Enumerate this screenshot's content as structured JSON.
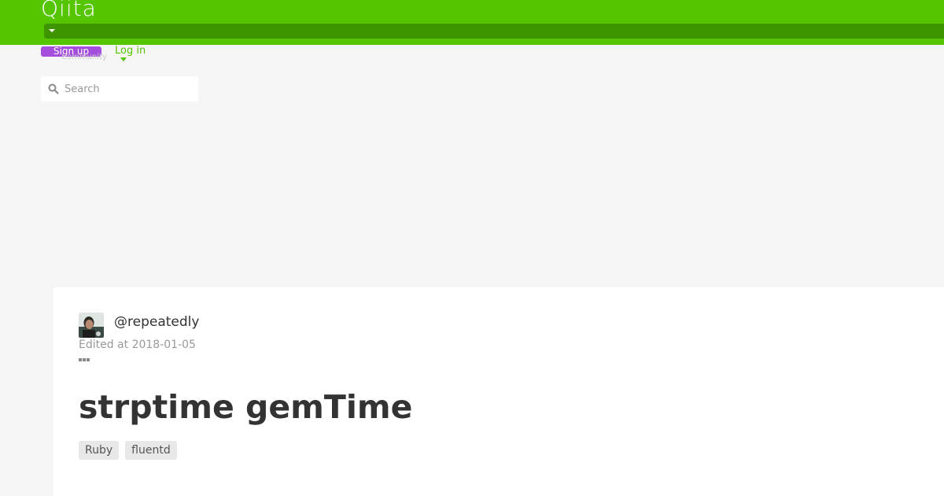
{
  "header": {
    "logo_text": "Qiita",
    "signup_label": "Sign up",
    "login_label": "Log in",
    "community_label": "Community",
    "search": {
      "placeholder": "Search"
    }
  },
  "article": {
    "author": "@repeatedly",
    "edited_at": "Edited at 2018-01-05",
    "title": "strptime gemTime",
    "tags": [
      "Ruby",
      "fluentd"
    ]
  },
  "colors": {
    "brand_green": "#55c500",
    "signup_purple": "#a54ddc",
    "background": "#f5f5f5"
  },
  "icons": {
    "search": "search-icon",
    "more": "more-options-icon",
    "caret": "caret-down-icon"
  }
}
